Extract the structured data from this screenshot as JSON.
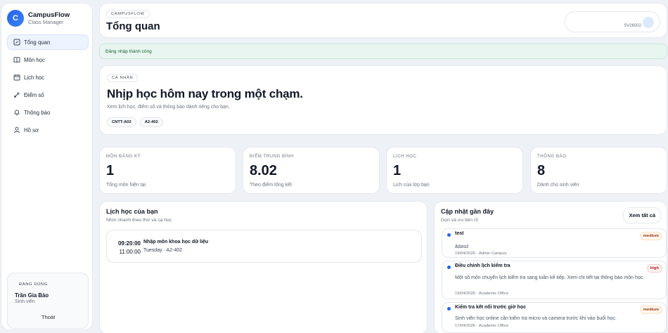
{
  "brand": {
    "logo_letter": "C",
    "name": "CampusFlow",
    "subtitle": "Class Manager"
  },
  "nav": [
    {
      "label": "Tổng quan",
      "icon": "dashboard-icon",
      "active": true
    },
    {
      "label": "Môn học",
      "icon": "book-icon"
    },
    {
      "label": "Lịch học",
      "icon": "calendar-icon"
    },
    {
      "label": "Điểm số",
      "icon": "grade-icon"
    },
    {
      "label": "Thông báo",
      "icon": "bell-icon"
    },
    {
      "label": "Hồ sơ",
      "icon": "user-icon"
    }
  ],
  "user": {
    "label": "ĐANG DÙNG",
    "name": "Trần Gia Bảo",
    "role": "Sinh viên",
    "logout": "Thoát"
  },
  "header": {
    "tag": "CAMPUSFLOW",
    "title": "Tổng quan",
    "pill_sub": "SV26002"
  },
  "alert": "Đăng nhập thành công",
  "hero": {
    "tag": "CÁ NHÂN",
    "title": "Nhịp học hôm nay trong một chạm.",
    "desc": "Xem lịch học, điểm số và thông báo dành riêng cho bạn.",
    "chips": [
      "CNTT-A02",
      "A2-402"
    ]
  },
  "stats": [
    {
      "label": "MÔN ĐĂNG KÝ",
      "value": "1",
      "sub": "Tổng môn hiện tại"
    },
    {
      "label": "ĐIỂM TRUNG BÌNH",
      "value": "8.02",
      "sub": "Theo điểm tổng kết"
    },
    {
      "label": "LỊCH HỌC",
      "value": "1",
      "sub": "Lịch của lớp bạn"
    },
    {
      "label": "THÔNG BÁO",
      "value": "8",
      "sub": "Dành cho sinh viên"
    }
  ],
  "schedule": {
    "title": "Lịch học của bạn",
    "subtitle": "Nhìn nhanh theo thứ và ca học",
    "items": [
      {
        "start": "09:20:00",
        "end": "11:00:00",
        "name": "Nhập môn khoa học dữ liệu",
        "meta": "Tuesday · A2-402"
      }
    ]
  },
  "updates": {
    "title": "Cập nhật gần đây",
    "subtitle": "Gọn và ưu tiên rõ",
    "see_all": "Xem tất cả",
    "items": [
      {
        "title": "test",
        "body": "ădasd",
        "meta": "19/04/2026 · Admin Campus",
        "priority": "medium"
      },
      {
        "title": "Điều chỉnh lịch kiểm tra",
        "body": "Một số môn chuyển lịch kiểm tra sang tuần kế tiếp. Xem chi tiết tại thông báo môn học.",
        "meta": "19/04/2026 · Academic Office",
        "priority": "high"
      },
      {
        "title": "Kiểm tra kết nối trước giờ học",
        "body": "Sinh viên học online cần kiểm tra micro và camera trước khi vào buổi học.",
        "meta": "17/04/2026 · Academic Office",
        "priority": "medium"
      }
    ]
  }
}
